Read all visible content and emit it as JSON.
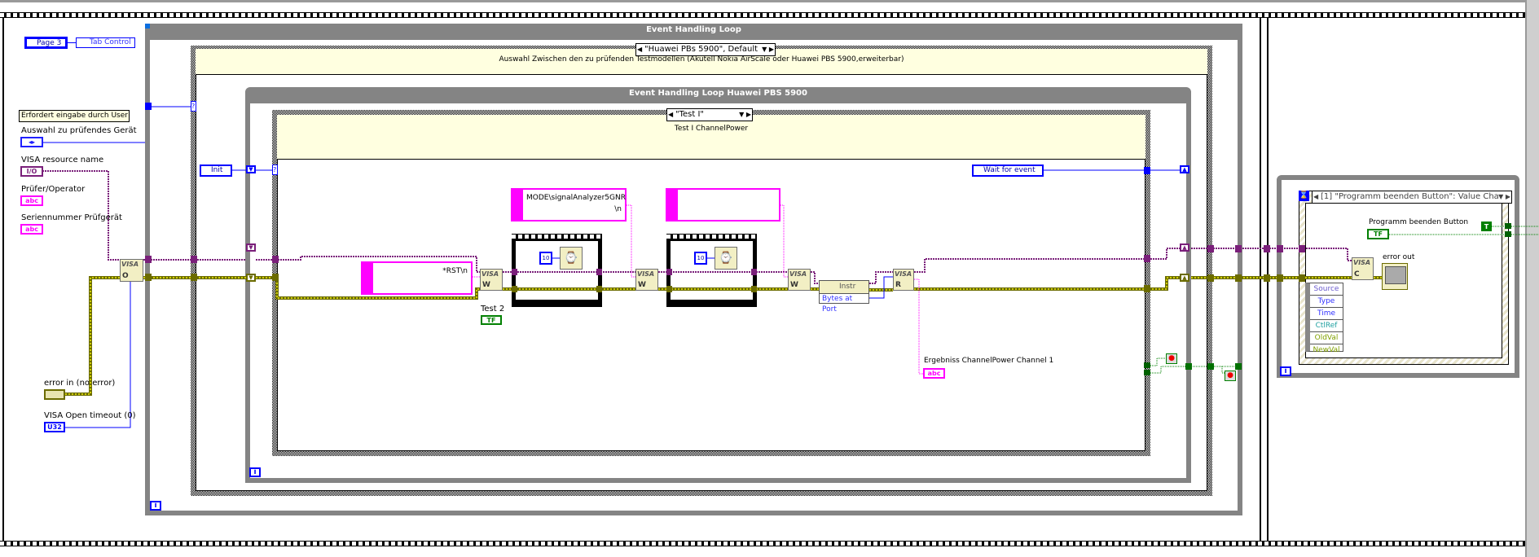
{
  "tab_control": {
    "selector": "Page 3",
    "label": "Tab Control"
  },
  "left_panel": {
    "comment": "Erfordert eingabe durch User",
    "device_select": {
      "label": "Auswahl zu prüfendes Gerät"
    },
    "visa_resource": {
      "label": "VISA resource name",
      "glyph": "I/O"
    },
    "operator": {
      "label": "Prüfer/Operator",
      "glyph": "abc"
    },
    "serial": {
      "label": "Seriennummer Prüfgerät",
      "glyph": "abc"
    },
    "error_in": {
      "label": "error in (no error)"
    },
    "visa_timeout": {
      "label": "VISA Open timeout (0)",
      "glyph": "U32"
    }
  },
  "outer_loop": {
    "title": "Event Handling Loop"
  },
  "outer_case": {
    "selector": "\"Huawei PBs 5900\", Default",
    "comment": "Auswahl Zwischen den zu prüfenden Testmodellen (Akutell Nokia AirScale oder Huawei PBS 5900,erweiterbar)"
  },
  "inner_loop": {
    "title": "Event Handling Loop Huawei PBS 5900"
  },
  "inner_case": {
    "selector": "\"Test I\"",
    "comment": "Test I ChannelPower"
  },
  "enums": {
    "init": "Init",
    "wait": "Wait for event"
  },
  "constants": {
    "rst": "*RST\\n",
    "mode_line1": "MODE\\signalAnalyzer5GNR",
    "mode_line2": "\\n",
    "wait1": "10",
    "wait2": "10"
  },
  "nodes": {
    "visa": "VISA",
    "open": "O",
    "write": "W",
    "read": "R",
    "close": "C",
    "property_class": "Instr",
    "property_item": "Bytes at Port"
  },
  "indicators": {
    "test2_label": "Test 2",
    "tf": "TF",
    "result_label": "Ergebniss ChannelPower Channel 1",
    "result_glyph": "abc"
  },
  "event_structure": {
    "selector": "[1] \"Programm beenden Button\": Value Cha",
    "button_label": "Programm beenden Button",
    "true_const": "T",
    "error_out": "error out",
    "event_data": [
      "Source",
      "Type",
      "Time",
      "CtlRef",
      "OldVal",
      "NewVal"
    ]
  },
  "loop_index": "i",
  "colors": {
    "visa_wire": "#7a1f7a",
    "error_wire": "#6b6b00",
    "string": "#ff00ff",
    "numeric": "#0000ff",
    "boolean": "#008000",
    "structure": "#848484",
    "comment_bg": "#ffffe0"
  }
}
